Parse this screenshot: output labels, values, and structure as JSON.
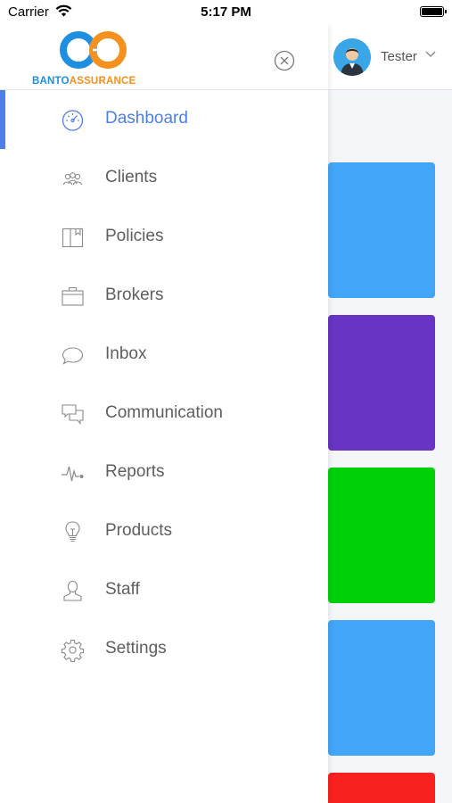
{
  "status_bar": {
    "carrier": "Carrier",
    "time": "5:17 PM"
  },
  "brand": {
    "logo_left": "BANTO",
    "logo_right": "ASSURANCE"
  },
  "header": {
    "user_name": "Tester"
  },
  "nav": {
    "active": "Dashboard",
    "items": [
      {
        "label": "Dashboard",
        "icon": "dashboard-gauge-icon"
      },
      {
        "label": "Clients",
        "icon": "clients-group-icon"
      },
      {
        "label": "Policies",
        "icon": "policies-book-icon"
      },
      {
        "label": "Brokers",
        "icon": "brokers-briefcase-icon"
      },
      {
        "label": "Inbox",
        "icon": "inbox-chat-bubble-icon"
      },
      {
        "label": "Communication",
        "icon": "communication-chat-icon"
      },
      {
        "label": "Reports",
        "icon": "reports-pulse-icon"
      },
      {
        "label": "Products",
        "icon": "products-lightbulb-icon"
      },
      {
        "label": "Staff",
        "icon": "staff-person-icon"
      },
      {
        "label": "Settings",
        "icon": "settings-gear-icon"
      }
    ]
  },
  "cards": [
    {
      "color": "#42a5f7"
    },
    {
      "color": "#6734c3"
    },
    {
      "color": "#00d00a"
    },
    {
      "color": "#42a5f7"
    },
    {
      "color": "#f7211f"
    }
  ],
  "colors": {
    "accent": "#4d7fe8",
    "logo_blue": "#1e8fe0",
    "logo_orange": "#f5911e",
    "nav_text": "#5e5e5e"
  }
}
